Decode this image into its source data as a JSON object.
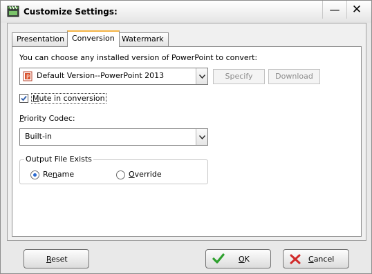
{
  "window": {
    "title": "Customize Settings:",
    "minimize_glyph": "—",
    "close_glyph": "✕"
  },
  "tabs": [
    {
      "label": "Presentation",
      "active": false
    },
    {
      "label": "Conversion",
      "active": true
    },
    {
      "label": "Watermark",
      "active": false
    }
  ],
  "conversion": {
    "powerpoint_prompt": "You can choose any installed version of PowerPoint to convert:",
    "powerpoint_version": {
      "value": "Default Version--PowerPoint 2013",
      "icon": "powerpoint-icon"
    },
    "specify_label": "Specify",
    "download_label": "Download",
    "mute": {
      "label_first": "M",
      "label_rest": "ute in conversion",
      "checked": true
    },
    "codec": {
      "label_first": "P",
      "label_rest": "riority Codec:",
      "value": "Built-in"
    },
    "output_group": {
      "title": "Output File Exists",
      "rename": {
        "label_pre": "Re",
        "label_ul": "n",
        "label_post": "ame",
        "selected": true
      },
      "override": {
        "label_pre": "",
        "label_ul": "O",
        "label_post": "verride",
        "selected": false
      }
    }
  },
  "footer": {
    "reset": {
      "label_ul": "R",
      "label_rest": "eset"
    },
    "ok": {
      "label_ul": "O",
      "label_rest": "K",
      "icon": "checkmark-icon"
    },
    "cancel": {
      "label_ul": "C",
      "label_rest": "ancel",
      "icon": "cross-icon"
    }
  },
  "colors": {
    "accent_tab": "#f5b342",
    "radio_selected": "#2c6bd1",
    "ok_green": "#2fa12f",
    "cancel_red": "#d12a2a"
  }
}
